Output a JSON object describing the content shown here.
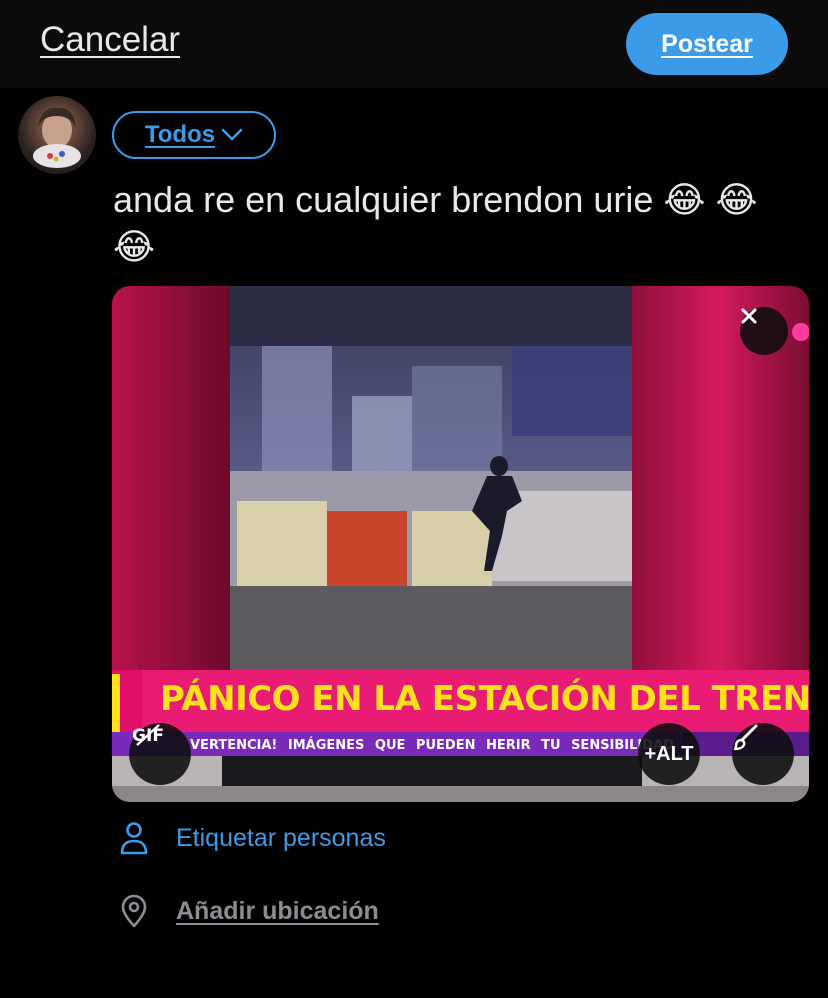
{
  "header": {
    "cancel_label": "Cancelar",
    "post_label": "Postear"
  },
  "composer": {
    "audience_label": "Todos",
    "text": "anda re en cualquier brendon urie 😂 😂 😂"
  },
  "media": {
    "headline": "PÁNICO EN LA ESTACIÓN DEL TREN",
    "ticker": "VERTENCIA!   IMÁGENES QUE PUEDEN HERIR TU SENSIBILIDAD",
    "gif_label": "GIF",
    "alt_label": "+ALT"
  },
  "actions": {
    "tag_label": "Etiquetar personas",
    "location_label": "Añadir ubicación"
  },
  "colors": {
    "accent": "#3b9be8",
    "background": "#000000",
    "headline_yellow": "#ffe11c",
    "banner_pink": "#e0106a"
  }
}
